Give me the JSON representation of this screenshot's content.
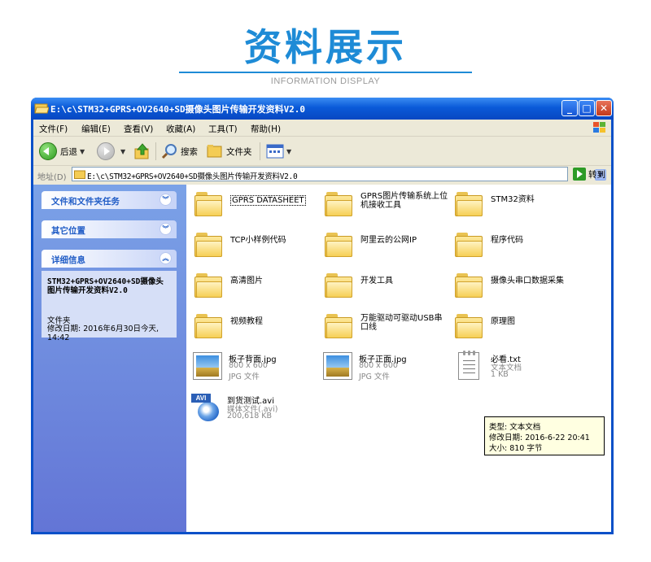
{
  "hero": {
    "title": "资料展示",
    "subtitle": "INFORMATION DISPLAY",
    "accent": "#1e8bd6"
  },
  "window": {
    "title": "E:\\c\\STM32+GPRS+OV2640+SD摄像头图片传输开发资料V2.0",
    "buttons": {
      "minimize": "_",
      "maximize": "□",
      "close": "✕"
    }
  },
  "menu": [
    "文件(F)",
    "编辑(E)",
    "查看(V)",
    "收藏(A)",
    "工具(T)",
    "帮助(H)"
  ],
  "toolbar": {
    "back": "后退",
    "search": "搜索",
    "folders": "文件夹"
  },
  "address": {
    "label": "地址(D)",
    "value": "E:\\c\\STM32+GPRS+OV2640+SD摄像头图片传输开发资料V2.0",
    "go": "转到"
  },
  "sidebar": {
    "sections": [
      {
        "title": "文件和文件夹任务",
        "chevron": "︾"
      },
      {
        "title": "其它位置",
        "chevron": "︾"
      },
      {
        "title": "详细信息",
        "chevron": "︽"
      }
    ],
    "details": {
      "name": "STM32+GPRS+OV2640+SD摄像头图片传输开发资料V2.0",
      "type": "文件夹",
      "modified": "修改日期: 2016年6月30日今天, 14:42"
    }
  },
  "items": [
    {
      "name": "GPRS DATASHEET",
      "kind": "folder"
    },
    {
      "name": "GPRS图片传输系统上位机接收工具",
      "kind": "folder"
    },
    {
      "name": "STM32资料",
      "kind": "folder"
    },
    {
      "name": "TCP小样例代码",
      "kind": "folder"
    },
    {
      "name": "阿里云的公网IP",
      "kind": "folder"
    },
    {
      "name": "程序代码",
      "kind": "folder"
    },
    {
      "name": "高清图片",
      "kind": "folder"
    },
    {
      "name": "开发工具",
      "kind": "folder"
    },
    {
      "name": "摄像头串口数据采集",
      "kind": "folder"
    },
    {
      "name": "视频教程",
      "kind": "folder"
    },
    {
      "name": "万能驱动可驱动USB串口线",
      "kind": "folder"
    },
    {
      "name": "原理图",
      "kind": "folder"
    }
  ],
  "files": [
    {
      "name": "板子背面.jpg",
      "line2": "800 x 600",
      "line3": "JPG 文件"
    },
    {
      "name": "板子正面.jpg",
      "line2": "800 x 600",
      "line3": "JPG 文件"
    },
    {
      "name": "必看.txt",
      "line2": "文本文档",
      "line3": "1 KB"
    },
    {
      "name": "到货测试.avi",
      "line2": "媒体文件(.avi)",
      "line3": "200,618 KB",
      "badge": "AVI"
    }
  ],
  "tooltip": {
    "type": "类型: 文本文档",
    "modified": "修改日期: 2016-6-22 20:41",
    "size": "大小: 810 字节"
  },
  "icons": {
    "back": "back-arrow-icon",
    "forward": "forward-arrow-icon",
    "up": "up-folder-icon",
    "search": "search-icon",
    "folders": "folders-icon",
    "views": "views-icon"
  }
}
